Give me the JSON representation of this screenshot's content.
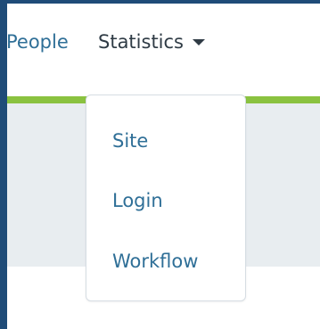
{
  "nav": {
    "people_label": "People",
    "statistics_label": "Statistics"
  },
  "dropdown": {
    "items": [
      {
        "label": "Site"
      },
      {
        "label": "Login"
      },
      {
        "label": "Workflow"
      }
    ]
  },
  "colors": {
    "frame": "#1f4c78",
    "accent": "#8ac240",
    "link": "#2f6f97",
    "text": "#2f3b45",
    "band": "#e8edf0"
  },
  "icons": {
    "statistics_caret": "chevron-down-icon"
  }
}
